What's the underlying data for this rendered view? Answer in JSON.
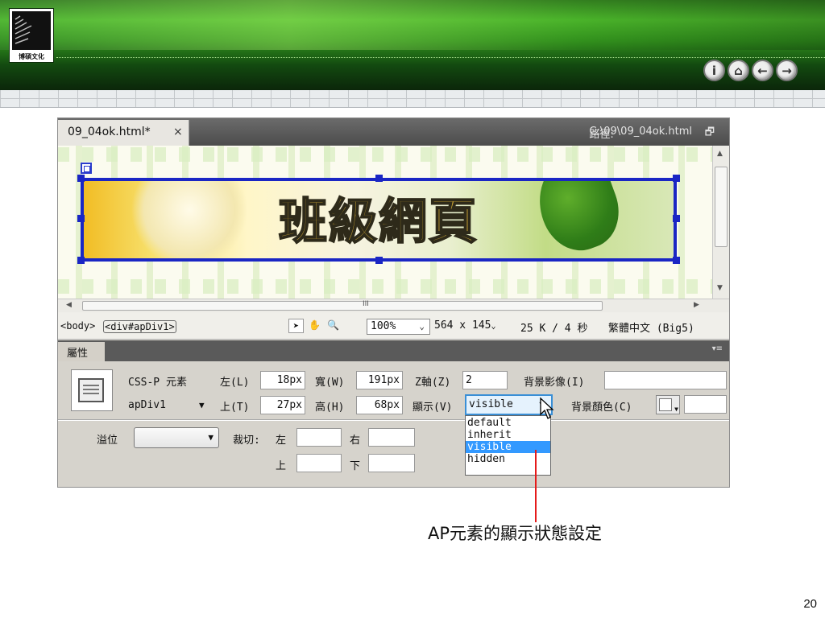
{
  "slide": {
    "logo_text": "博碩文化",
    "nav_buttons": [
      {
        "name": "info-icon",
        "glyph": "i"
      },
      {
        "name": "home-icon",
        "glyph": "⌂"
      },
      {
        "name": "back-icon",
        "glyph": "←"
      },
      {
        "name": "forward-icon",
        "glyph": "→"
      }
    ],
    "callout": "AP元素的顯示狀態設定",
    "page_number": "20",
    "accent_color": "#e51b1b"
  },
  "document": {
    "tab_label": "09_04ok.html*",
    "tab_close": "×",
    "path_label": "路徑:",
    "path_value": "C:\\09\\09_04ok.html",
    "banner_title": "班級網頁"
  },
  "statusbar": {
    "tag_body": "<body>",
    "tag_div": "<div#apDiv1>",
    "zoom": "100%",
    "size": "564 x 145",
    "download": "25 K / 4 秒",
    "encoding": "繁體中文 (Big5)",
    "scroll_grip": "III"
  },
  "properties": {
    "panel_title": "屬性",
    "element_type": "CSS-P 元素",
    "element_id": "apDiv1",
    "left_label": "左(L)",
    "left_value": "18px",
    "top_label": "上(T)",
    "top_value": "27px",
    "width_label": "寬(W)",
    "width_value": "191px",
    "height_label": "高(H)",
    "height_value": "68px",
    "z_label": "Z軸(Z)",
    "z_value": "2",
    "vis_label": "顯示(V)",
    "vis_value": "visible",
    "bg_image_label": "背景影像(I)",
    "bg_image_value": "",
    "bg_color_label": "背景顏色(C)",
    "bg_color_value": "",
    "overflow_label": "溢位",
    "overflow_value": "",
    "clip_label": "裁切:",
    "clip_left_label": "左",
    "clip_right_label": "右",
    "clip_top_label": "上",
    "clip_bottom_label": "下",
    "vis_options": [
      "default",
      "inherit",
      "visible",
      "hidden"
    ],
    "vis_selected_index": 2
  },
  "colors": {
    "selection_blue": "#1a26c4",
    "dropdown_highlight": "#3399ff",
    "header_green": "#49b42a"
  }
}
